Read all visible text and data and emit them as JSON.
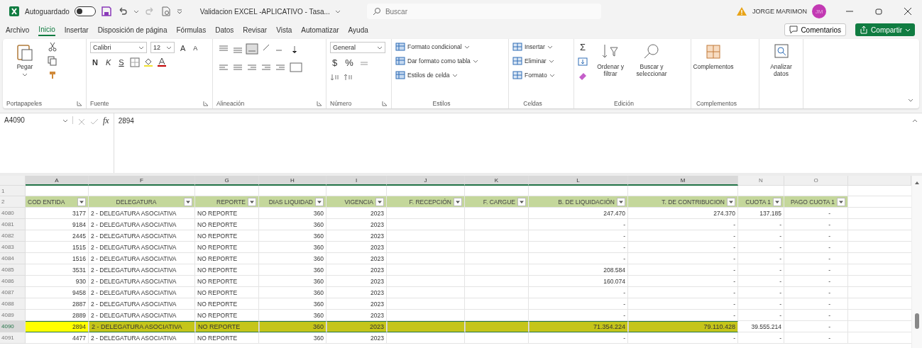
{
  "title_bar": {
    "autosave_label": "Autoguardado",
    "autosave_on": false,
    "document_title": "Validacion EXCEL -APLICATIVO - Tasa...",
    "search": {
      "placeholder": "Buscar"
    },
    "user_name": "JORGE MARIMON",
    "avatar_initials": "JM"
  },
  "menu_tabs": [
    {
      "label": "Archivo",
      "selected": false
    },
    {
      "label": "Inicio",
      "selected": true
    },
    {
      "label": "Insertar",
      "selected": false
    },
    {
      "label": "Disposición de página",
      "selected": false
    },
    {
      "label": "Fórmulas",
      "selected": false
    },
    {
      "label": "Datos",
      "selected": false
    },
    {
      "label": "Revisar",
      "selected": false
    },
    {
      "label": "Vista",
      "selected": false
    },
    {
      "label": "Automatizar",
      "selected": false
    },
    {
      "label": "Ayuda",
      "selected": false
    }
  ],
  "comments_button": "Comentarios",
  "share_button": "Compartir",
  "ribbon": {
    "clipboard": {
      "paste": "Pegar",
      "label": "Portapapeles"
    },
    "font": {
      "family": "Calibri",
      "size": "12",
      "grow": "A",
      "shrink": "A",
      "bold": "N",
      "italic": "K",
      "underline": "S",
      "label": "Fuente"
    },
    "alignment": {
      "label": "Alineación"
    },
    "number": {
      "format": "General",
      "currency": "$",
      "percent": "%",
      "label": "Número"
    },
    "styles": {
      "items": [
        "Formato condicional",
        "Dar formato como tabla",
        "Estilos de celda"
      ],
      "label": "Estilos"
    },
    "cells": {
      "items": [
        "Insertar",
        "Eliminar",
        "Formato"
      ],
      "label": "Celdas"
    },
    "editing": {
      "sum": "Σ",
      "sort": "Ordenar y filtrar",
      "find": "Buscar y seleccionar",
      "label": "Edición"
    },
    "addins": {
      "button": "Complementos",
      "label": "Complementos"
    },
    "analyze": {
      "button": "Analizar datos"
    }
  },
  "formula_bar": {
    "name_box": "A4090",
    "fx": "fx",
    "value": "2894"
  },
  "column_headers": [
    {
      "letter": "A",
      "selected": true
    },
    {
      "letter": "F",
      "selected": true
    },
    {
      "letter": "G",
      "selected": true
    },
    {
      "letter": "H",
      "selected": true
    },
    {
      "letter": "I",
      "selected": true
    },
    {
      "letter": "J",
      "selected": true
    },
    {
      "letter": "K",
      "selected": true
    },
    {
      "letter": "L",
      "selected": true
    },
    {
      "letter": "M",
      "selected": true
    },
    {
      "letter": "N",
      "selected": false
    },
    {
      "letter": "O",
      "selected": false
    }
  ],
  "row_1": "1",
  "table": {
    "row_number": "2",
    "columns": [
      "COD ENTIDA",
      "DELEGATURA",
      "REPORTE",
      "DIAS LIQUIDAD",
      "VIGENCIA",
      "F. RECEPCIÓN",
      "F. CARGUE",
      "B. DE LIQUIDACIÓN",
      "T. DE CONTRIBUCION",
      "CUOTA 1",
      "PAGO CUOTA 1"
    ],
    "rows": [
      {
        "row_number": "4080",
        "selected": false,
        "cod": "3177",
        "delegatura": "2 - DELEGATURA ASOCIATIVA",
        "reporte": "NO REPORTE",
        "dias": "360",
        "vigencia": "2023",
        "b_liquidacion": "247.470",
        "t_contribucion": "274.370",
        "cuota_1": "137.185",
        "pago_cuota_1": "-"
      },
      {
        "row_number": "4081",
        "selected": false,
        "cod": "9184",
        "delegatura": "2 - DELEGATURA ASOCIATIVA",
        "reporte": "NO REPORTE",
        "dias": "360",
        "vigencia": "2023",
        "b_liquidacion": "-",
        "t_contribucion": "-",
        "cuota_1": "-",
        "pago_cuota_1": "-"
      },
      {
        "row_number": "4082",
        "selected": false,
        "cod": "2445",
        "delegatura": "2 - DELEGATURA ASOCIATIVA",
        "reporte": "NO REPORTE",
        "dias": "360",
        "vigencia": "2023",
        "b_liquidacion": "-",
        "t_contribucion": "-",
        "cuota_1": "-",
        "pago_cuota_1": "-"
      },
      {
        "row_number": "4083",
        "selected": false,
        "cod": "1515",
        "delegatura": "2 - DELEGATURA ASOCIATIVA",
        "reporte": "NO REPORTE",
        "dias": "360",
        "vigencia": "2023",
        "b_liquidacion": "-",
        "t_contribucion": "-",
        "cuota_1": "-",
        "pago_cuota_1": "-"
      },
      {
        "row_number": "4084",
        "selected": false,
        "cod": "1516",
        "delegatura": "2 - DELEGATURA ASOCIATIVA",
        "reporte": "NO REPORTE",
        "dias": "360",
        "vigencia": "2023",
        "b_liquidacion": "-",
        "t_contribucion": "-",
        "cuota_1": "-",
        "pago_cuota_1": "-"
      },
      {
        "row_number": "4085",
        "selected": false,
        "cod": "3531",
        "delegatura": "2 - DELEGATURA ASOCIATIVA",
        "reporte": "NO REPORTE",
        "dias": "360",
        "vigencia": "2023",
        "b_liquidacion": "208.584",
        "t_contribucion": "-",
        "cuota_1": "-",
        "pago_cuota_1": "-"
      },
      {
        "row_number": "4086",
        "selected": false,
        "cod": "930",
        "delegatura": "2 - DELEGATURA ASOCIATIVA",
        "reporte": "NO REPORTE",
        "dias": "360",
        "vigencia": "2023",
        "b_liquidacion": "160.074",
        "t_contribucion": "-",
        "cuota_1": "-",
        "pago_cuota_1": "-"
      },
      {
        "row_number": "4087",
        "selected": false,
        "cod": "9458",
        "delegatura": "2 - DELEGATURA ASOCIATIVA",
        "reporte": "NO REPORTE",
        "dias": "360",
        "vigencia": "2023",
        "b_liquidacion": "-",
        "t_contribucion": "-",
        "cuota_1": "-",
        "pago_cuota_1": "-"
      },
      {
        "row_number": "4088",
        "selected": false,
        "cod": "2887",
        "delegatura": "2 - DELEGATURA ASOCIATIVA",
        "reporte": "NO REPORTE",
        "dias": "360",
        "vigencia": "2023",
        "b_liquidacion": "-",
        "t_contribucion": "-",
        "cuota_1": "-",
        "pago_cuota_1": "-"
      },
      {
        "row_number": "4089",
        "selected": false,
        "cod": "2889",
        "delegatura": "2 - DELEGATURA ASOCIATIVA",
        "reporte": "NO REPORTE",
        "dias": "360",
        "vigencia": "2023",
        "b_liquidacion": "-",
        "t_contribucion": "-",
        "cuota_1": "-",
        "pago_cuota_1": "-"
      },
      {
        "row_number": "4090",
        "selected": true,
        "cod": "2894",
        "delegatura": "2 - DELEGATURA ASOCIATIVA",
        "reporte": "NO REPORTE",
        "dias": "360",
        "vigencia": "2023",
        "b_liquidacion": "71.354.224",
        "t_contribucion": "79.110.428",
        "cuota_1": "39.555.214",
        "pago_cuota_1": "-"
      },
      {
        "row_number": "4091",
        "selected": false,
        "cod": "4477",
        "delegatura": "2 - DELEGATURA ASOCIATIVA",
        "reporte": "NO REPORTE",
        "dias": "360",
        "vigencia": "2023",
        "b_liquidacion": "-",
        "t_contribucion": "-",
        "cuota_1": "-",
        "pago_cuota_1": "-"
      }
    ]
  }
}
